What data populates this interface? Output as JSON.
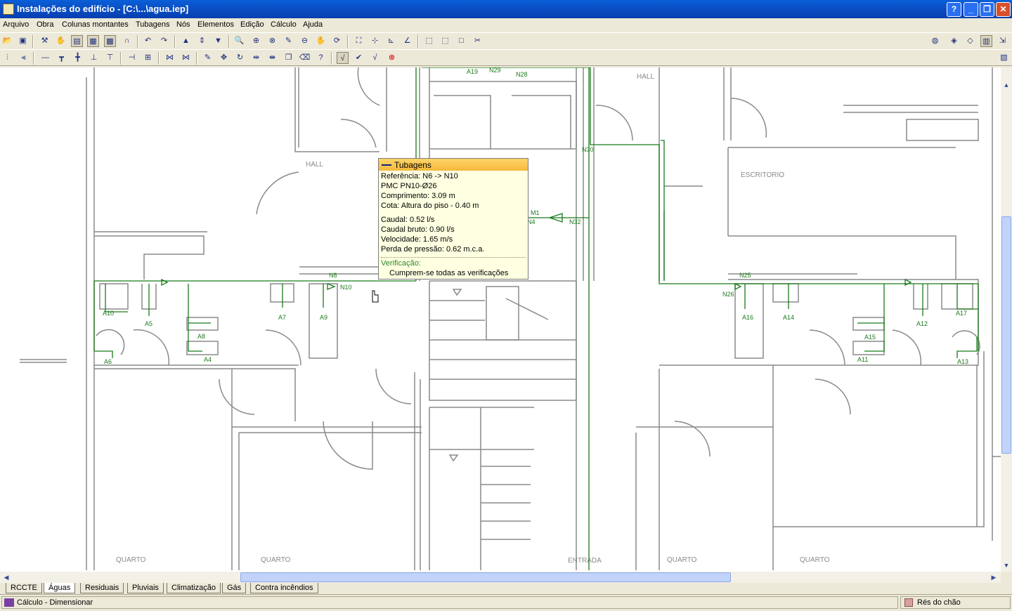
{
  "window": {
    "title": "Instalações do edifício - [C:\\...\\agua.iep]",
    "buttons": {
      "help": "?",
      "minimize": "_",
      "restore": "❐",
      "close": "✕"
    }
  },
  "menu": [
    "Arquivo",
    "Obra",
    "Colunas montantes",
    "Tubagens",
    "Nós",
    "Elementos",
    "Edição",
    "Cálculo",
    "Ajuda"
  ],
  "plan": {
    "rooms": [
      "HALL",
      "HALL",
      "ESCRITORIO",
      "QUARTO",
      "QUARTO",
      "ENTRADA",
      "QUARTO",
      "QUARTO"
    ],
    "nodes": [
      "A19",
      "N29",
      "N28",
      "N30",
      "M1",
      "N4",
      "N32",
      "N8",
      "N10",
      "N25",
      "N26"
    ],
    "fixtures_left": [
      "A10",
      "A5",
      "A7",
      "A9",
      "A8",
      "A4",
      "A6"
    ],
    "fixtures_right": [
      "A16",
      "A14",
      "A12",
      "A17",
      "A15",
      "A11",
      "A13"
    ]
  },
  "tooltip": {
    "title": "Tubagens",
    "referencia": "Referência: N6 -> N10",
    "material": "PMC PN10-Ø26",
    "comprimento": "Comprimento: 3.09 m",
    "cota": "Cota: Altura do piso - 0.40 m",
    "caudal": "Caudal: 0.52 l/s",
    "caudal_bruto": "Caudal bruto: 0.90 l/s",
    "velocidade": "Velocidade: 1.65 m/s",
    "perda": "Perda de pressão: 0.62 m.c.a.",
    "verificacao_label": "Verificação:",
    "verificacao_result": "Cumprem-se todas as verificações"
  },
  "tabs": [
    "RCCTE",
    "Águas",
    "Residuais",
    "Pluviais",
    "Climatização",
    "Gás",
    "Contra incêndios"
  ],
  "active_tab": "Águas",
  "status": {
    "left": "Cálculo - Dimensionar",
    "right": "Rés do chão"
  },
  "colors": {
    "pipe": "#1a7a1a",
    "wall": "#8a8a8a",
    "title_bar": "#0a50c8",
    "tooltip_bg": "#ffffe1"
  }
}
